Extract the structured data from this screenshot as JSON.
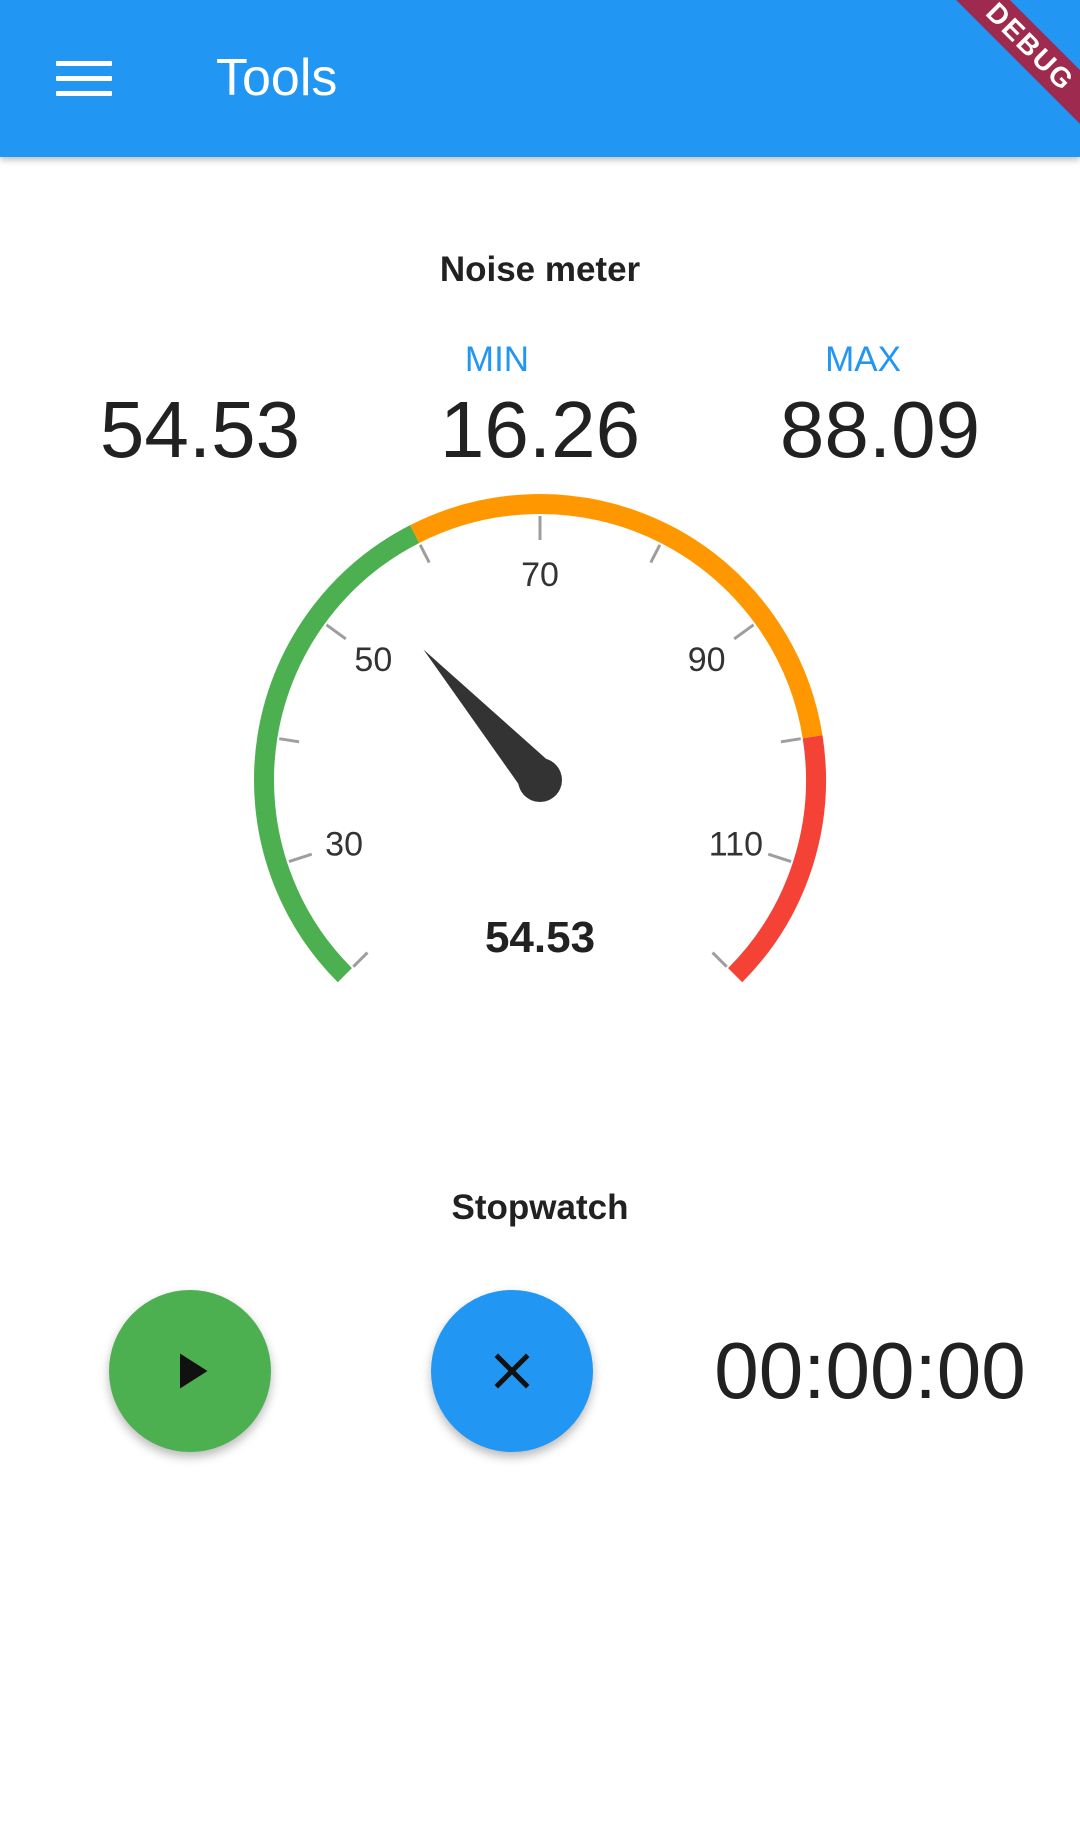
{
  "app_bar": {
    "title": "Tools",
    "menu_icon": "hamburger-menu-icon",
    "debug_banner": "DEBUG",
    "color": "#2196F3"
  },
  "noise_meter": {
    "title": "Noise meter",
    "current_value": "54.53",
    "min_label": "MIN",
    "min_value": "16.26",
    "max_label": "MAX",
    "max_value": "88.09",
    "gauge": {
      "value": 54.53,
      "value_label": "54.53",
      "range_min": 20,
      "range_max": 120,
      "major_ticks": [
        "30",
        "50",
        "70",
        "90",
        "110"
      ],
      "ranges": [
        {
          "from": 20,
          "to": 60,
          "color": "#4CAF50"
        },
        {
          "from": 60,
          "to": 100,
          "color": "#FF9800"
        },
        {
          "from": 100,
          "to": 120,
          "color": "#F44336"
        }
      ],
      "needle_color": "#333333"
    }
  },
  "stopwatch": {
    "title": "Stopwatch",
    "time": "00:00:00",
    "play_icon": "play-icon",
    "reset_icon": "close-icon",
    "play_color": "#4CAF50",
    "reset_color": "#2196F3"
  }
}
